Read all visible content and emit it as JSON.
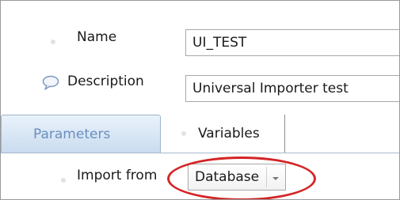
{
  "form": {
    "name_label": "Name",
    "name_value": "UI_TEST",
    "description_label": "Description",
    "description_value": "Universal Importer test"
  },
  "tabs": [
    {
      "label": "Parameters",
      "selected": true
    },
    {
      "label": "Variables",
      "selected": false
    }
  ],
  "import": {
    "label": "Import from",
    "selected_value": "Database"
  },
  "icons": {
    "description": "speech-bubble-icon",
    "dropdown": "chevron-down-icon"
  },
  "colors": {
    "annotation_circle": "#d42525",
    "tab_active_text": "#6b8fbf"
  }
}
